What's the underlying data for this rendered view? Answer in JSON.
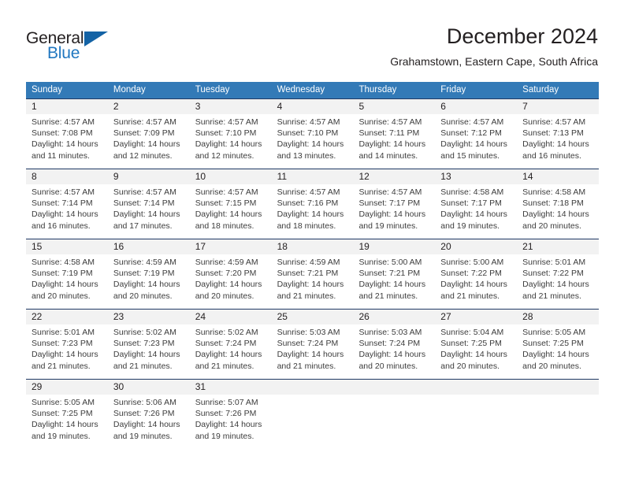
{
  "brand": {
    "name_top": "General",
    "name_bottom": "Blue",
    "triangle_icon": "blue-triangle-logo-mark",
    "color_dark": "#231f20",
    "color_blue": "#2077c0"
  },
  "header": {
    "month_title": "December 2024",
    "location": "Grahamstown, Eastern Cape, South Africa"
  },
  "calendar": {
    "header_bg": "#337ab7",
    "header_text_color": "#ffffff",
    "daynum_band_bg": "#f2f2f2",
    "week_rule_color": "#1f3864",
    "day_headers": [
      "Sunday",
      "Monday",
      "Tuesday",
      "Wednesday",
      "Thursday",
      "Friday",
      "Saturday"
    ],
    "weeks": [
      {
        "numbers": [
          "1",
          "2",
          "3",
          "4",
          "5",
          "6",
          "7"
        ],
        "days": [
          {
            "date": "1",
            "sunrise": "Sunrise: 4:57 AM",
            "sunset": "Sunset: 7:08 PM",
            "daylight1": "Daylight: 14 hours",
            "daylight2": "and 11 minutes."
          },
          {
            "date": "2",
            "sunrise": "Sunrise: 4:57 AM",
            "sunset": "Sunset: 7:09 PM",
            "daylight1": "Daylight: 14 hours",
            "daylight2": "and 12 minutes."
          },
          {
            "date": "3",
            "sunrise": "Sunrise: 4:57 AM",
            "sunset": "Sunset: 7:10 PM",
            "daylight1": "Daylight: 14 hours",
            "daylight2": "and 12 minutes."
          },
          {
            "date": "4",
            "sunrise": "Sunrise: 4:57 AM",
            "sunset": "Sunset: 7:10 PM",
            "daylight1": "Daylight: 14 hours",
            "daylight2": "and 13 minutes."
          },
          {
            "date": "5",
            "sunrise": "Sunrise: 4:57 AM",
            "sunset": "Sunset: 7:11 PM",
            "daylight1": "Daylight: 14 hours",
            "daylight2": "and 14 minutes."
          },
          {
            "date": "6",
            "sunrise": "Sunrise: 4:57 AM",
            "sunset": "Sunset: 7:12 PM",
            "daylight1": "Daylight: 14 hours",
            "daylight2": "and 15 minutes."
          },
          {
            "date": "7",
            "sunrise": "Sunrise: 4:57 AM",
            "sunset": "Sunset: 7:13 PM",
            "daylight1": "Daylight: 14 hours",
            "daylight2": "and 16 minutes."
          }
        ]
      },
      {
        "numbers": [
          "8",
          "9",
          "10",
          "11",
          "12",
          "13",
          "14"
        ],
        "days": [
          {
            "date": "8",
            "sunrise": "Sunrise: 4:57 AM",
            "sunset": "Sunset: 7:14 PM",
            "daylight1": "Daylight: 14 hours",
            "daylight2": "and 16 minutes."
          },
          {
            "date": "9",
            "sunrise": "Sunrise: 4:57 AM",
            "sunset": "Sunset: 7:14 PM",
            "daylight1": "Daylight: 14 hours",
            "daylight2": "and 17 minutes."
          },
          {
            "date": "10",
            "sunrise": "Sunrise: 4:57 AM",
            "sunset": "Sunset: 7:15 PM",
            "daylight1": "Daylight: 14 hours",
            "daylight2": "and 18 minutes."
          },
          {
            "date": "11",
            "sunrise": "Sunrise: 4:57 AM",
            "sunset": "Sunset: 7:16 PM",
            "daylight1": "Daylight: 14 hours",
            "daylight2": "and 18 minutes."
          },
          {
            "date": "12",
            "sunrise": "Sunrise: 4:57 AM",
            "sunset": "Sunset: 7:17 PM",
            "daylight1": "Daylight: 14 hours",
            "daylight2": "and 19 minutes."
          },
          {
            "date": "13",
            "sunrise": "Sunrise: 4:58 AM",
            "sunset": "Sunset: 7:17 PM",
            "daylight1": "Daylight: 14 hours",
            "daylight2": "and 19 minutes."
          },
          {
            "date": "14",
            "sunrise": "Sunrise: 4:58 AM",
            "sunset": "Sunset: 7:18 PM",
            "daylight1": "Daylight: 14 hours",
            "daylight2": "and 20 minutes."
          }
        ]
      },
      {
        "numbers": [
          "15",
          "16",
          "17",
          "18",
          "19",
          "20",
          "21"
        ],
        "days": [
          {
            "date": "15",
            "sunrise": "Sunrise: 4:58 AM",
            "sunset": "Sunset: 7:19 PM",
            "daylight1": "Daylight: 14 hours",
            "daylight2": "and 20 minutes."
          },
          {
            "date": "16",
            "sunrise": "Sunrise: 4:59 AM",
            "sunset": "Sunset: 7:19 PM",
            "daylight1": "Daylight: 14 hours",
            "daylight2": "and 20 minutes."
          },
          {
            "date": "17",
            "sunrise": "Sunrise: 4:59 AM",
            "sunset": "Sunset: 7:20 PM",
            "daylight1": "Daylight: 14 hours",
            "daylight2": "and 20 minutes."
          },
          {
            "date": "18",
            "sunrise": "Sunrise: 4:59 AM",
            "sunset": "Sunset: 7:21 PM",
            "daylight1": "Daylight: 14 hours",
            "daylight2": "and 21 minutes."
          },
          {
            "date": "19",
            "sunrise": "Sunrise: 5:00 AM",
            "sunset": "Sunset: 7:21 PM",
            "daylight1": "Daylight: 14 hours",
            "daylight2": "and 21 minutes."
          },
          {
            "date": "20",
            "sunrise": "Sunrise: 5:00 AM",
            "sunset": "Sunset: 7:22 PM",
            "daylight1": "Daylight: 14 hours",
            "daylight2": "and 21 minutes."
          },
          {
            "date": "21",
            "sunrise": "Sunrise: 5:01 AM",
            "sunset": "Sunset: 7:22 PM",
            "daylight1": "Daylight: 14 hours",
            "daylight2": "and 21 minutes."
          }
        ]
      },
      {
        "numbers": [
          "22",
          "23",
          "24",
          "25",
          "26",
          "27",
          "28"
        ],
        "days": [
          {
            "date": "22",
            "sunrise": "Sunrise: 5:01 AM",
            "sunset": "Sunset: 7:23 PM",
            "daylight1": "Daylight: 14 hours",
            "daylight2": "and 21 minutes."
          },
          {
            "date": "23",
            "sunrise": "Sunrise: 5:02 AM",
            "sunset": "Sunset: 7:23 PM",
            "daylight1": "Daylight: 14 hours",
            "daylight2": "and 21 minutes."
          },
          {
            "date": "24",
            "sunrise": "Sunrise: 5:02 AM",
            "sunset": "Sunset: 7:24 PM",
            "daylight1": "Daylight: 14 hours",
            "daylight2": "and 21 minutes."
          },
          {
            "date": "25",
            "sunrise": "Sunrise: 5:03 AM",
            "sunset": "Sunset: 7:24 PM",
            "daylight1": "Daylight: 14 hours",
            "daylight2": "and 21 minutes."
          },
          {
            "date": "26",
            "sunrise": "Sunrise: 5:03 AM",
            "sunset": "Sunset: 7:24 PM",
            "daylight1": "Daylight: 14 hours",
            "daylight2": "and 20 minutes."
          },
          {
            "date": "27",
            "sunrise": "Sunrise: 5:04 AM",
            "sunset": "Sunset: 7:25 PM",
            "daylight1": "Daylight: 14 hours",
            "daylight2": "and 20 minutes."
          },
          {
            "date": "28",
            "sunrise": "Sunrise: 5:05 AM",
            "sunset": "Sunset: 7:25 PM",
            "daylight1": "Daylight: 14 hours",
            "daylight2": "and 20 minutes."
          }
        ]
      },
      {
        "numbers": [
          "29",
          "30",
          "31",
          "",
          "",
          "",
          ""
        ],
        "days": [
          {
            "date": "29",
            "sunrise": "Sunrise: 5:05 AM",
            "sunset": "Sunset: 7:25 PM",
            "daylight1": "Daylight: 14 hours",
            "daylight2": "and 19 minutes."
          },
          {
            "date": "30",
            "sunrise": "Sunrise: 5:06 AM",
            "sunset": "Sunset: 7:26 PM",
            "daylight1": "Daylight: 14 hours",
            "daylight2": "and 19 minutes."
          },
          {
            "date": "31",
            "sunrise": "Sunrise: 5:07 AM",
            "sunset": "Sunset: 7:26 PM",
            "daylight1": "Daylight: 14 hours",
            "daylight2": "and 19 minutes."
          },
          {
            "date": "",
            "sunrise": "",
            "sunset": "",
            "daylight1": "",
            "daylight2": ""
          },
          {
            "date": "",
            "sunrise": "",
            "sunset": "",
            "daylight1": "",
            "daylight2": ""
          },
          {
            "date": "",
            "sunrise": "",
            "sunset": "",
            "daylight1": "",
            "daylight2": ""
          },
          {
            "date": "",
            "sunrise": "",
            "sunset": "",
            "daylight1": "",
            "daylight2": ""
          }
        ]
      }
    ]
  }
}
